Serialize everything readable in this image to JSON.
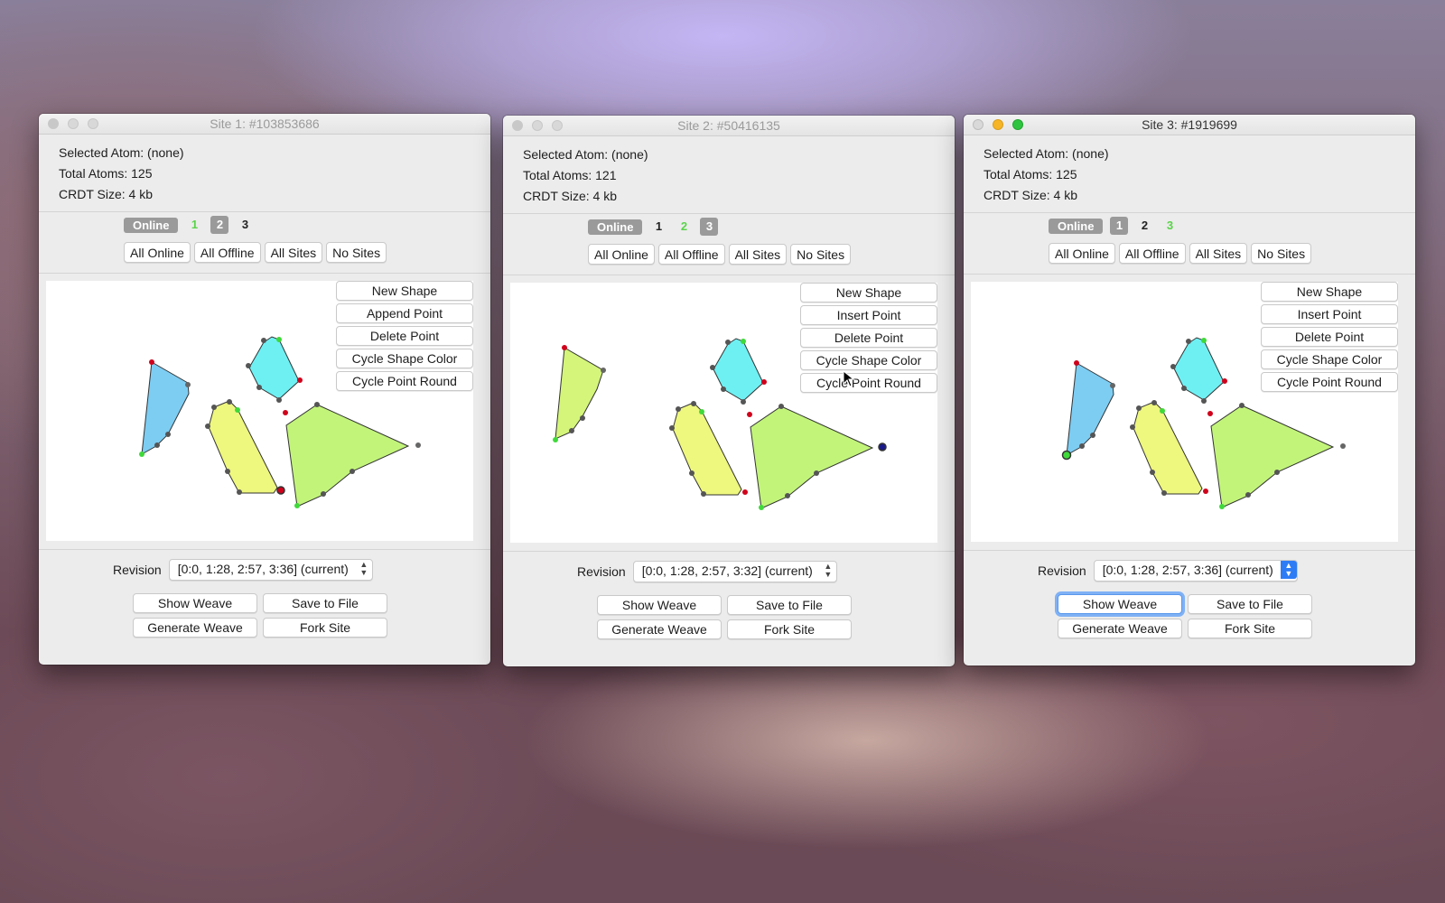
{
  "labels": {
    "selected_atom": "Selected Atom: (none)",
    "crdt_size": "CRDT Size: 4 kb",
    "online": "Online",
    "all_online": "All Online",
    "all_offline": "All Offline",
    "all_sites": "All Sites",
    "no_sites": "No Sites",
    "new_shape": "New Shape",
    "delete_point": "Delete Point",
    "cycle_shape_color": "Cycle Shape Color",
    "cycle_point_round": "Cycle Point Round",
    "revision": "Revision",
    "show_weave": "Show Weave",
    "save_to_file": "Save to File",
    "generate_weave": "Generate Weave",
    "fork_site": "Fork Site"
  },
  "windows": [
    {
      "title": "Site 1: #103853686",
      "total_atoms": "Total Atoms: 125",
      "sites": [
        "1",
        "2",
        "3"
      ],
      "site_states": [
        "on",
        "me",
        "off"
      ],
      "point_button": "Append Point",
      "revision": "[0:0, 1:28, 2:57, 3:36] (current)"
    },
    {
      "title": "Site 2: #50416135",
      "total_atoms": "Total Atoms: 121",
      "sites": [
        "1",
        "2",
        "3"
      ],
      "site_states": [
        "off",
        "on",
        "me"
      ],
      "point_button": "Insert Point",
      "revision": "[0:0, 1:28, 2:57, 3:32] (current)"
    },
    {
      "title": "Site 3: #1919699",
      "total_atoms": "Total Atoms: 125",
      "sites": [
        "1",
        "2",
        "3"
      ],
      "site_states": [
        "me",
        "off",
        "on"
      ],
      "point_button": "Insert Point",
      "revision": "[0:0, 1:28, 2:57, 3:36] (current)"
    }
  ],
  "colors": {
    "cyan_shape": "#6ef0f3",
    "blue_shape": "#7dcdf3",
    "yellow_shape": "#eef77e",
    "green_shape": "#c2f47a",
    "point_dark": "#555555",
    "point_red": "#d0021b",
    "point_green": "#3fd93a"
  }
}
